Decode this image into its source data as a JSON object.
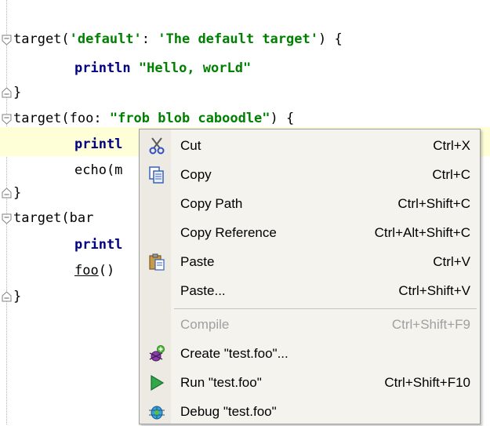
{
  "editor": {
    "lines": [
      {
        "pre": "target(",
        "str": "'default'",
        "mid": ": ",
        "str2": "'The default target'",
        "post": ") {"
      },
      {
        "call": "println",
        "str": " \"Hello, worLd\""
      },
      {
        "text": "}"
      },
      {
        "pre": "target(foo: ",
        "str": "\"frob blob caboodle\"",
        "post": ") {"
      },
      {
        "call": "printl"
      },
      {
        "text": "echo(m"
      },
      {
        "text": "}"
      },
      {
        "text": "target(bar"
      },
      {
        "call": "printl"
      },
      {
        "ul": "foo",
        "post": "()"
      },
      {
        "text": "}"
      }
    ]
  },
  "context_menu": {
    "items": [
      {
        "label": "Cut",
        "shortcut": "Ctrl+X",
        "icon": "scissors-icon"
      },
      {
        "label": "Copy",
        "shortcut": "Ctrl+C",
        "icon": "copy-icon"
      },
      {
        "label": "Copy Path",
        "shortcut": "Ctrl+Shift+C",
        "icon": ""
      },
      {
        "label": "Copy Reference",
        "shortcut": "Ctrl+Alt+Shift+C",
        "icon": ""
      },
      {
        "label": "Paste",
        "shortcut": "Ctrl+V",
        "icon": "paste-icon"
      },
      {
        "label": "Paste...",
        "shortcut": "Ctrl+Shift+V",
        "icon": ""
      },
      {
        "label": "Compile",
        "shortcut": "Ctrl+Shift+F9",
        "icon": "",
        "disabled": true
      },
      {
        "label": "Create \"test.foo\"...",
        "shortcut": "",
        "icon": "create-config-icon"
      },
      {
        "label": "Run \"test.foo\"",
        "shortcut": "Ctrl+Shift+F10",
        "icon": "run-icon"
      },
      {
        "label": "Debug \"test.foo\"",
        "shortcut": "",
        "icon": "debug-icon"
      }
    ]
  },
  "colors": {
    "string": "#008000",
    "keyword_call": "#000080",
    "caret_row": "#ffffd7",
    "menu_bg": "#f4f3ee",
    "disabled": "#a0a0a0"
  }
}
